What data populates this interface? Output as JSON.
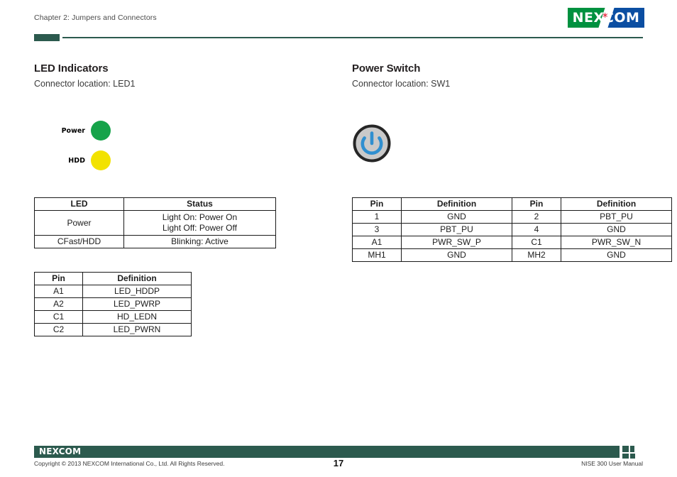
{
  "header": {
    "chapter": "Chapter 2: Jumpers and Connectors",
    "logo_text": "NEXCOM",
    "logo_left_word": "NE",
    "logo_right_word": "COM",
    "logo_star": "*",
    "brand_green": "#00913f",
    "brand_blue": "#0b4ea2",
    "brand_red": "#e2001a",
    "rule_color": "#2c5a4e"
  },
  "left_section": {
    "title": "LED Indicators",
    "subtitle": "Connector location: LED1",
    "leds": [
      {
        "label": "Power",
        "color": "#16a34a",
        "color_name": "green"
      },
      {
        "label": "HDD",
        "color": "#f2e200",
        "color_name": "yellow"
      }
    ],
    "status_table": {
      "headers": [
        "LED",
        "Status"
      ],
      "rows": [
        {
          "led": "Power",
          "status_line1": "Light On: Power On",
          "status_line2": "Light Off: Power Off"
        },
        {
          "led": "CFast/HDD",
          "status_line1": "Blinking: Active",
          "status_line2": ""
        }
      ]
    },
    "pin_table": {
      "headers": [
        "Pin",
        "Definition"
      ],
      "rows": [
        {
          "pin": "A1",
          "definition": "LED_HDDP"
        },
        {
          "pin": "A2",
          "definition": "LED_PWRP"
        },
        {
          "pin": "C1",
          "definition": "HD_LEDN"
        },
        {
          "pin": "C2",
          "definition": "LED_PWRN"
        }
      ]
    }
  },
  "right_section": {
    "title": "Power Switch",
    "subtitle": "Connector location: SW1",
    "power_button": {
      "icon": "power-symbol",
      "ring_color": "#2a2a2a",
      "face_color": "#c9c9c9",
      "symbol_color": "#2f8fd0"
    },
    "pin_table": {
      "headers": [
        "Pin",
        "Definition",
        "Pin",
        "Definition"
      ],
      "rows": [
        {
          "pin_a": "1",
          "def_a": "GND",
          "pin_b": "2",
          "def_b": "PBT_PU"
        },
        {
          "pin_a": "3",
          "def_a": "PBT_PU",
          "pin_b": "4",
          "def_b": "GND"
        },
        {
          "pin_a": "A1",
          "def_a": "PWR_SW_P",
          "pin_b": "C1",
          "def_b": "PWR_SW_N"
        },
        {
          "pin_a": "MH1",
          "def_a": "GND",
          "pin_b": "MH2",
          "def_b": "GND"
        }
      ]
    }
  },
  "footer": {
    "logo_text": "NEXCOM",
    "copyright": "Copyright © 2013 NEXCOM International Co., Ltd. All Rights Reserved.",
    "page_number": "17",
    "manual_title": "NISE 300 User Manual",
    "bar_color": "#2c5a4e"
  }
}
